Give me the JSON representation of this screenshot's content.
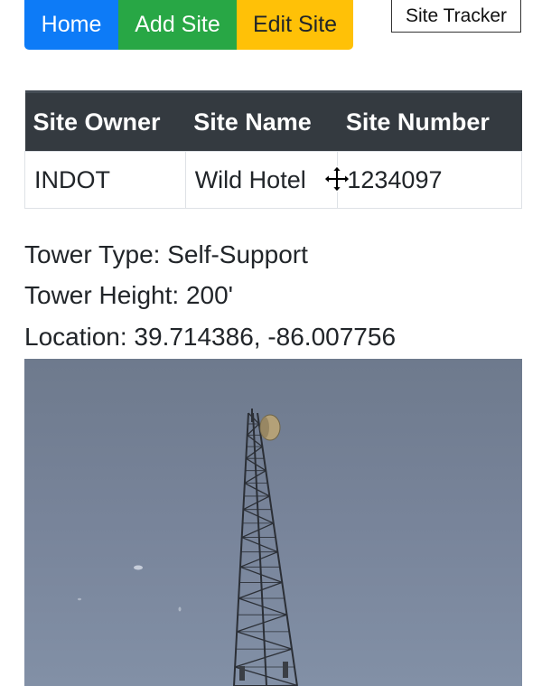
{
  "nav": {
    "home_label": "Home",
    "add_site_label": "Add Site",
    "edit_site_label": "Edit Site",
    "brand_label": "Site Tracker",
    "colors": {
      "home": "#0d7bf7",
      "add_site": "#28a745",
      "edit_site": "#ffc107"
    }
  },
  "table": {
    "headers": [
      "Site Owner",
      "Site Name",
      "Site Number"
    ],
    "rows": [
      [
        "INDOT",
        "Wild Hotel",
        "1234097"
      ]
    ]
  },
  "details": {
    "tower_type": "Tower Type: Self-Support",
    "tower_height": "Tower Height: 200'",
    "location": "Location: 39.714386, -86.007756"
  },
  "image": {
    "subject": "lattice-cell-tower-street-view"
  },
  "cursor": {
    "icon": "move-cursor-icon"
  }
}
